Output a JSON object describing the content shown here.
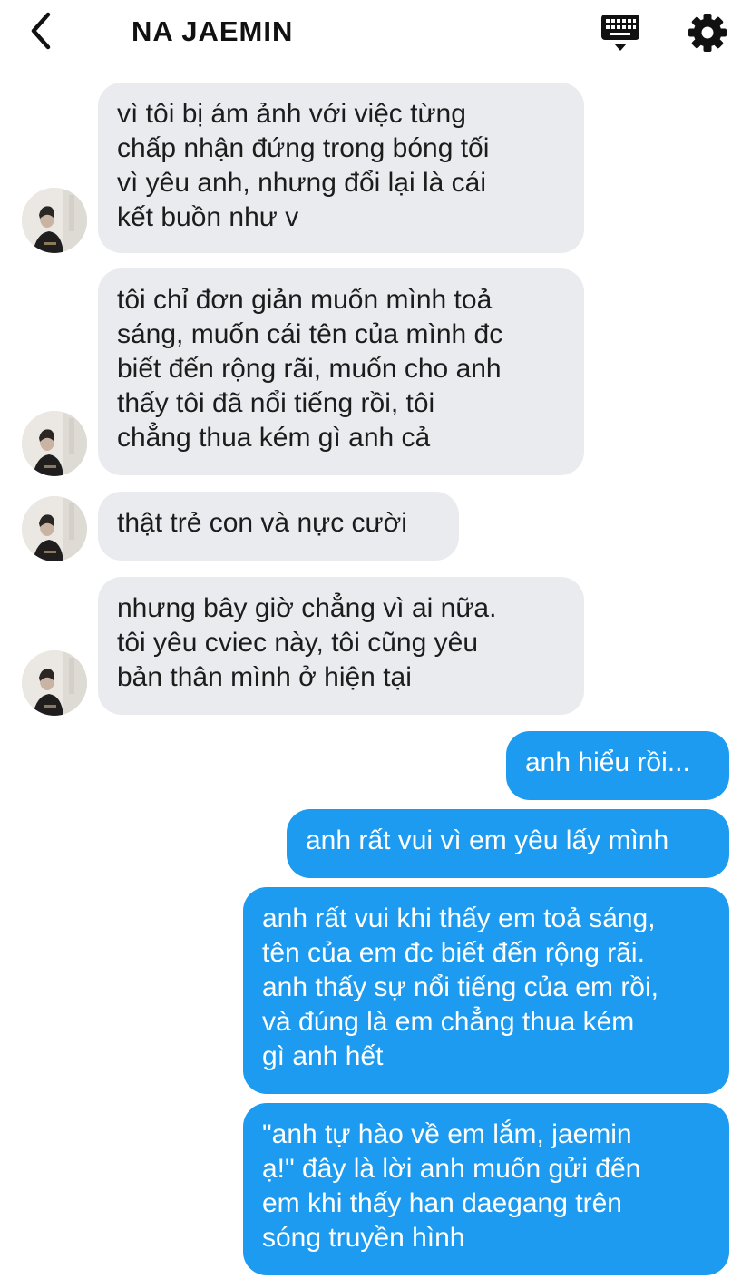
{
  "header": {
    "back_icon": "chevron-left-icon",
    "title": "NA JAEMIN",
    "keyboard_icon": "keyboard-icon",
    "settings_icon": "gear-icon"
  },
  "colors": {
    "incoming_bubble": "#e9ebee",
    "outgoing_bubble": "#1d9bf0"
  },
  "messages": [
    {
      "direction": "incoming",
      "text": "vì tôi bị ám ảnh với việc từng\nchấp nhận đứng trong bóng tối\nvì yêu anh, nhưng đổi lại là cái\nkết buồn như v"
    },
    {
      "direction": "incoming",
      "text": "tôi chỉ đơn giản muốn mình toả\nsáng, muốn cái tên của mình đc\nbiết đến rộng rãi, muốn cho anh\nthấy tôi đã nổi tiếng rồi, tôi\nchẳng thua kém gì anh cả"
    },
    {
      "direction": "incoming",
      "text": "thật trẻ con và nực cười"
    },
    {
      "direction": "incoming",
      "text": "nhưng bây giờ chẳng vì ai nữa.\ntôi yêu cviec này, tôi cũng yêu\nbản thân mình ở hiện tại"
    },
    {
      "direction": "outgoing",
      "text": "anh hiểu rồi..."
    },
    {
      "direction": "outgoing",
      "text": "anh rất vui vì em yêu lấy mình"
    },
    {
      "direction": "outgoing",
      "text": "anh rất vui khi thấy em toả sáng,\ntên của em đc biết đến rộng rãi.\nanh thấy sự nổi tiếng của em rồi,\nvà đúng là em chẳng thua kém\ngì anh hết"
    },
    {
      "direction": "outgoing",
      "text": "\"anh tự hào về em lắm, jaemin\nạ!\" đây là lời anh muốn gửi đến\nem khi thấy han daegang trên\nsóng truyền hình"
    }
  ]
}
